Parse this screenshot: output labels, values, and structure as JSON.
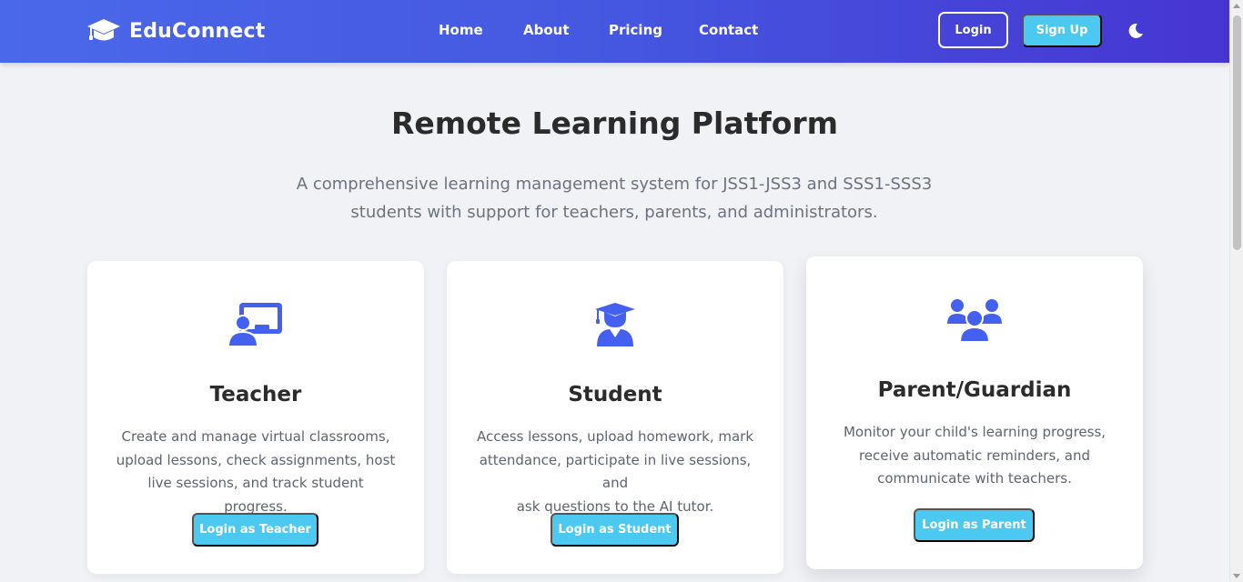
{
  "brand": {
    "name": "EduConnect",
    "icon": "graduation-cap-icon"
  },
  "nav": {
    "home": "Home",
    "about": "About",
    "pricing": "Pricing",
    "contact": "Contact"
  },
  "auth": {
    "login": "Login",
    "signup": "Sign Up"
  },
  "theme_toggle_icon": "moon-icon",
  "hero": {
    "title": "Remote Learning Platform",
    "subtitle_line1": "A comprehensive learning management system for JSS1-JSS3 and SSS1-SSS3",
    "subtitle_line2": "students with support for teachers, parents, and administrators."
  },
  "roles": {
    "teacher": {
      "icon": "chalkboard-teacher-icon",
      "title": "Teacher",
      "desc": [
        "Create and manage virtual classrooms,",
        "upload lessons, check assignments, host",
        "live sessions, and track student progress."
      ],
      "button": "Login as Teacher"
    },
    "student": {
      "icon": "graduate-student-icon",
      "title": "Student",
      "desc": [
        "Access lessons, upload homework, mark",
        "attendance, participate in live sessions, and",
        "ask questions to the AI tutor."
      ],
      "button": "Login as Student"
    },
    "parent": {
      "icon": "users-group-icon",
      "title": "Parent/Guardian",
      "desc": [
        "Monitor your child's learning progress,",
        "receive automatic reminders, and",
        "communicate with teachers."
      ],
      "button": "Login as Parent"
    }
  },
  "colors": {
    "brand_blue": "#4361ee",
    "accent": "#4cc9f0",
    "nav_gradient_end": "#4635d2"
  }
}
